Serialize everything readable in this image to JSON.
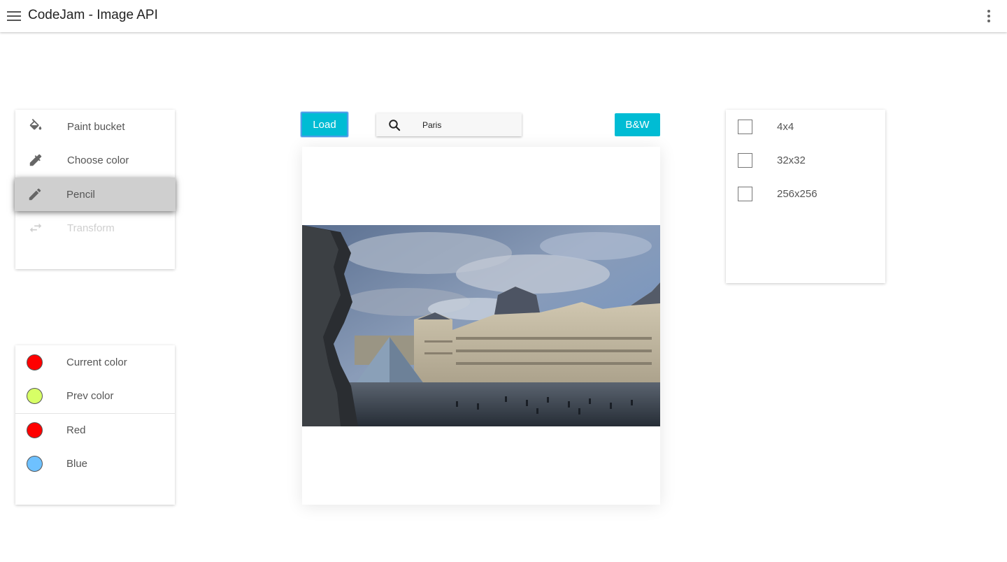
{
  "app": {
    "title": "CodeJam - Image API"
  },
  "tools": [
    {
      "label": "Paint bucket",
      "icon": "paint-bucket-icon",
      "state": "normal"
    },
    {
      "label": "Choose color",
      "icon": "eyedropper-icon",
      "state": "normal"
    },
    {
      "label": "Pencil",
      "icon": "pencil-icon",
      "state": "active"
    },
    {
      "label": "Transform",
      "icon": "transform-icon",
      "state": "disabled"
    }
  ],
  "colors": {
    "current": {
      "label": "Current color",
      "color": "#ff0000"
    },
    "prev": {
      "label": "Prev color",
      "color": "#d7ff66"
    },
    "presets": [
      {
        "label": "Red",
        "color": "#ff0000"
      },
      {
        "label": "Blue",
        "color": "#6ec1ff"
      }
    ]
  },
  "toolbar": {
    "load_label": "Load",
    "search_value": "Paris",
    "bw_label": "B&W"
  },
  "sizes": [
    {
      "label": "4x4",
      "checked": false
    },
    {
      "label": "32x32",
      "checked": false
    },
    {
      "label": "256x256",
      "checked": false
    }
  ],
  "theme": {
    "accent": "#00bcd4",
    "active_tool_bg": "#cfcfcf"
  }
}
